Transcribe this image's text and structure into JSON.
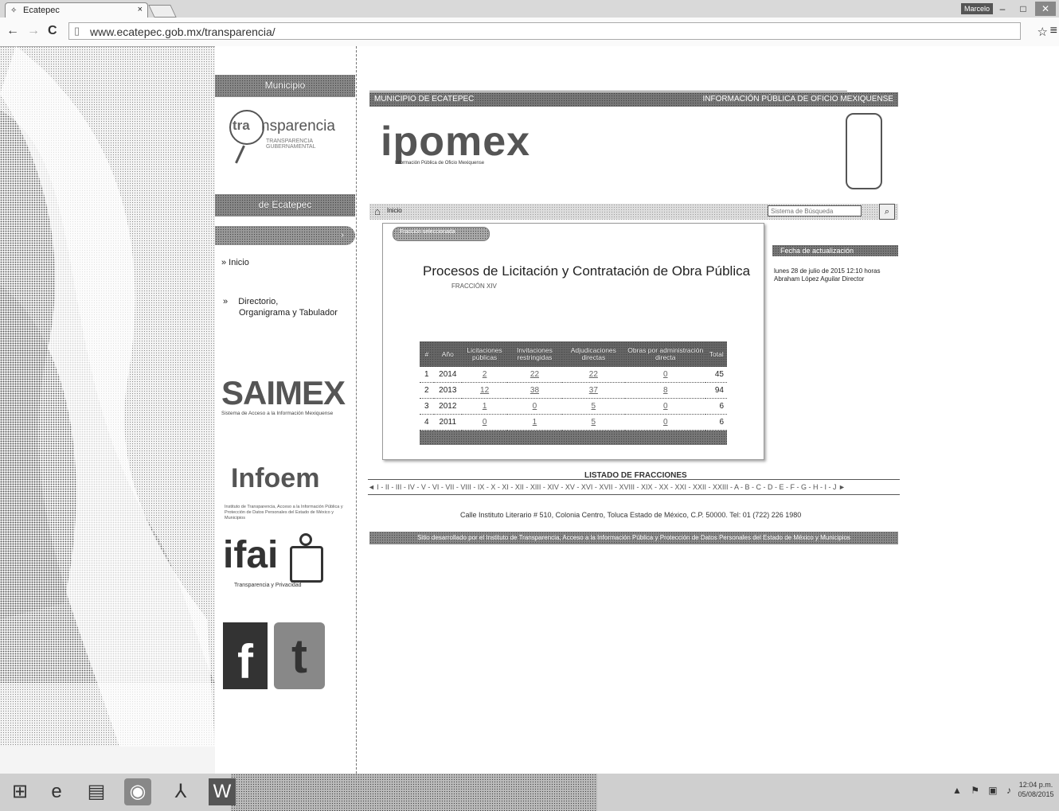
{
  "browser": {
    "tab_title": "Ecatepec",
    "tab_close": "×",
    "url": "www.ecatepec.gob.mx/transparencia/",
    "user_badge": "Marcelo",
    "buttons": {
      "back": "←",
      "forward": "→",
      "reload": "C",
      "star": "☆",
      "menu": "≡",
      "minimize": "–",
      "maximize": "□",
      "close": "✕"
    }
  },
  "left_column": {
    "top_bar": "Municipio",
    "logo_word": "nsparencia",
    "logo_prefix": "tra",
    "logo_sub": "TRANSPARENCIA GUBERNAMENTAL",
    "mid_bar": "de Ecatepec",
    "menu": {
      "inicio": "» Inicio",
      "directorio_bullet": "»",
      "directorio_line1": "Directorio,",
      "directorio_line2": "Organigrama y Tabulador"
    },
    "saimex": {
      "title": "SAIMEX",
      "sub": "Sistema de Acceso a la Información Mexiquense"
    },
    "infoem": {
      "title": "Infoem",
      "sub": "Instituto de Transparencia, Acceso a la Información Pública y Protección de Datos Personales del Estado de México y Municipios"
    },
    "ifai": {
      "title": "ifai",
      "sub": "Transparencia y Privacidad"
    },
    "social": {
      "facebook": "f",
      "twitter": "t"
    }
  },
  "main": {
    "header_left": "MUNICIPIO DE ECATEPEC",
    "header_right": "INFORMACIÓN PÚBLICA DE OFICIO MEXIQUENSE",
    "brand": "ipomex",
    "brand_sub": "Información Pública de Oficio Mexiquense",
    "home_label": "Inicio",
    "search_placeholder": "Sistema de Búsqueda",
    "pill_label": "Fracción seleccionada",
    "title": "Procesos de Licitación y Contratación de Obra Pública",
    "subtitle": "FRACCIÓN XIV",
    "table": {
      "headers": [
        "#",
        "Año",
        "Licitaciones públicas",
        "Invitaciones restringidas",
        "Adjudicaciones directas",
        "Obras por administración directa",
        "Total"
      ],
      "rows": [
        [
          "1",
          "2014",
          "2",
          "22",
          "22",
          "0",
          "45"
        ],
        [
          "2",
          "2013",
          "12",
          "38",
          "37",
          "8",
          "94"
        ],
        [
          "3",
          "2012",
          "1",
          "0",
          "5",
          "0",
          "6"
        ],
        [
          "4",
          "2011",
          "0",
          "1",
          "5",
          "0",
          "6"
        ]
      ]
    },
    "side_header": "Fecha de actualización",
    "side_date": "lunes 28 de julio de 2015 12:10 horas",
    "side_person": "Abraham López Aguilar Director",
    "list_title": "LISTADO DE FRACCIONES",
    "fractions": "◄ I - II - III - IV - V - VI - VII - VIII - IX - X - XI - XII - XIII - XIV - XV - XVI - XVII - XVIII - XIX - XX - XXI - XXII - XXIII - A - B - C - D - E - F - G - H - I - J ►",
    "address": "Calle Instituto Literario # 510, Colonia Centro, Toluca Estado de México, C.P. 50000. Tel: 01 (722) 226 1980",
    "footer": "Sitio desarrollado por el Instituto de Transparencia, Acceso a la Información Pública y Protección de Datos Personales del Estado de México y Municipios"
  },
  "taskbar": {
    "icons": [
      "windows-icon",
      "ie-icon",
      "explorer-icon",
      "chrome-icon",
      "acrobat-icon",
      "word-icon"
    ],
    "time": "12:04 p.m.",
    "date": "05/08/2015",
    "tray": "▲ ⚑ ▣ ♪"
  },
  "colors": {
    "bar_dark": "#555555",
    "bar_mid": "#888888",
    "accent": "#333333"
  }
}
